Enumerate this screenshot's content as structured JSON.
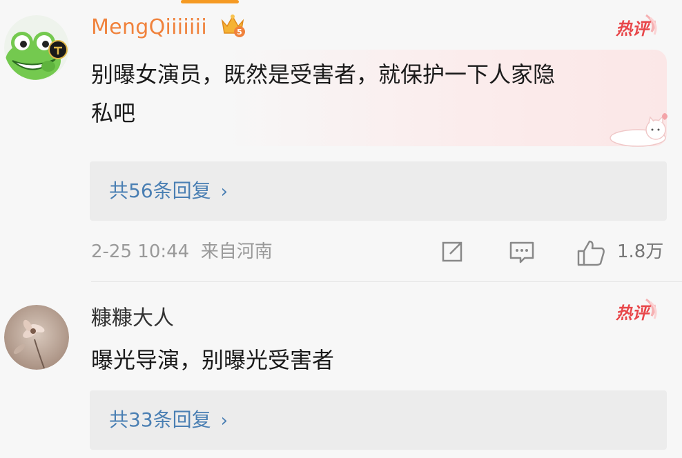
{
  "comments": [
    {
      "username": "MengQiiiiiii",
      "vip_level": "5",
      "hot_tag": "热评",
      "text_lines": [
        "别曝女演员，既然是受害者，就保护一下人家隐",
        "私吧"
      ],
      "replies_label": "共56条回复",
      "time": "2-25 10:44",
      "location": "来自河南",
      "like_count": "1.8万",
      "avatar_icon": "frog-avatar-icon"
    },
    {
      "username": "糠糠大人",
      "hot_tag": "热评",
      "text_lines": [
        "曝光导演，别曝光受害者"
      ],
      "replies_label": "共33条回复",
      "avatar_icon": "flower-avatar-icon"
    }
  ],
  "colors": {
    "vip_name": "#f0823c",
    "hot_tag": "#e8474a",
    "reply_link": "#4a7fb3",
    "tab_indicator": "#f59a23"
  }
}
